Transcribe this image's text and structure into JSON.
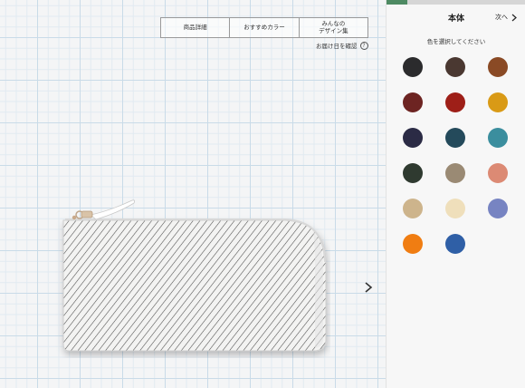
{
  "header_tabs": [
    {
      "label": "商品詳細"
    },
    {
      "label": "おすすめカラー"
    },
    {
      "label": "みんなの\nデザイン集"
    }
  ],
  "delivery": {
    "label": "お届け日を確認",
    "icon": "question-circle-icon",
    "icon_glyph": "?"
  },
  "preview": {
    "next_icon": "chevron-right-icon"
  },
  "panel": {
    "progress": 0.15,
    "title": "本体",
    "next_label": "次へ",
    "subtitle": "色を選択してください"
  },
  "swatches": [
    {
      "color": "#2b2b2d"
    },
    {
      "color": "#4a3831"
    },
    {
      "color": "#8a4a25"
    },
    {
      "color": "#6d2422"
    },
    {
      "color": "#9e1f18"
    },
    {
      "color": "#d99a16"
    },
    {
      "color": "#2b2b45"
    },
    {
      "color": "#244a5b"
    },
    {
      "color": "#3b8e9e"
    },
    {
      "color": "#2f3a30"
    },
    {
      "color": "#9a8a74"
    },
    {
      "color": "#dc8a74"
    },
    {
      "color": "#cdb48c"
    },
    {
      "color": "#efdfbb"
    },
    {
      "color": "#7784c2"
    },
    {
      "color": "#f07d12"
    },
    {
      "color": "#2f5fa6"
    }
  ]
}
